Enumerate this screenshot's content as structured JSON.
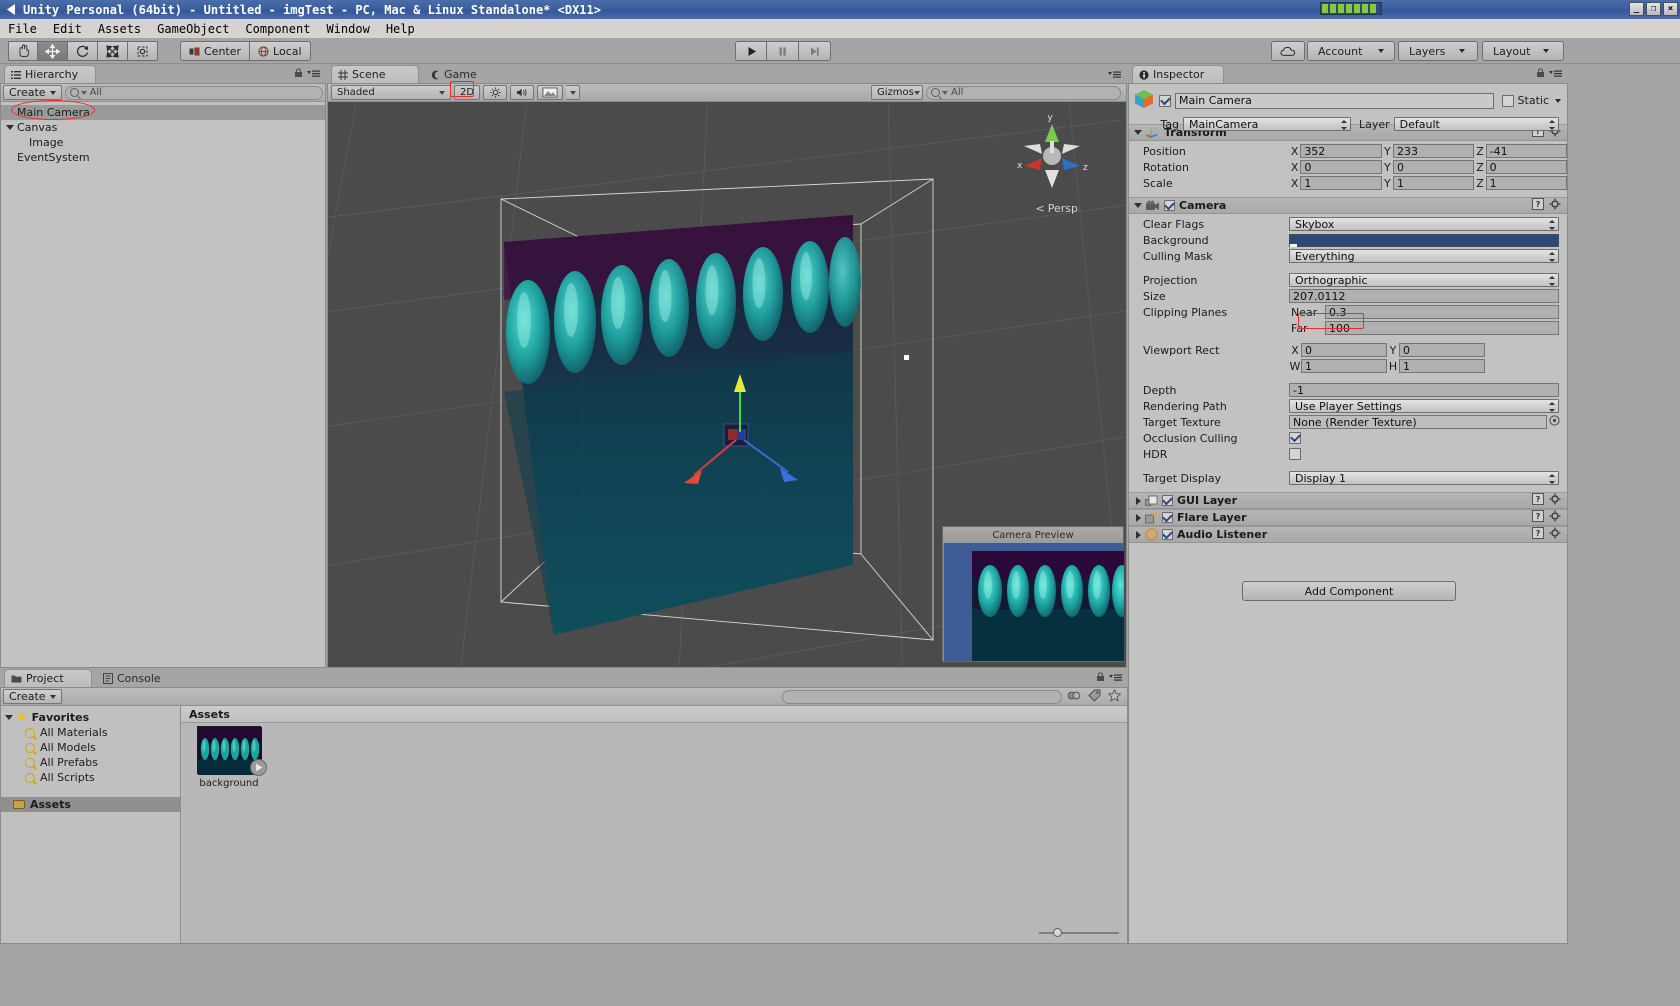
{
  "window": {
    "title": "Unity Personal (64bit) - Untitled - imgTest - PC, Mac & Linux Standalone* <DX11>",
    "minimize_label": "_",
    "restore_label": "❐",
    "close_label": "×"
  },
  "menubar": {
    "items": [
      "File",
      "Edit",
      "Assets",
      "GameObject",
      "Component",
      "Window",
      "Help"
    ]
  },
  "toolbar": {
    "tools": [
      {
        "name": "hand-tool",
        "glyph": "✋"
      },
      {
        "name": "move-tool",
        "glyph": "✥"
      },
      {
        "name": "rotate-tool",
        "glyph": "↻"
      },
      {
        "name": "scale-tool",
        "glyph": "⤢"
      },
      {
        "name": "rect-tool",
        "glyph": "▣"
      }
    ],
    "pivot_label": "Center",
    "space_label": "Local",
    "play_label": "▶",
    "pause_label": "❚❚",
    "step_label": "▶❘",
    "cloud_label": "☁",
    "account_label": "Account",
    "layers_label": "Layers",
    "layout_label": "Layout"
  },
  "hierarchy": {
    "tab_label": "Hierarchy",
    "create_label": "Create",
    "search_placeholder": "All",
    "items": [
      {
        "label": "Main Camera",
        "indent": 0,
        "selected": true,
        "foldout": "none"
      },
      {
        "label": "Canvas",
        "indent": 0,
        "selected": false,
        "foldout": "open"
      },
      {
        "label": "Image",
        "indent": 1,
        "selected": false,
        "foldout": "none"
      },
      {
        "label": "EventSystem",
        "indent": 0,
        "selected": false,
        "foldout": "none"
      }
    ]
  },
  "scene": {
    "tab_scene_label": "Scene",
    "tab_game_label": "Game",
    "shading_label": "Shaded",
    "twod_label": "2D",
    "light_label": "☼",
    "audio_label": "ᴘ",
    "fx_label": "▣",
    "gizmos_label": "Gizmos",
    "search_placeholder": "All",
    "persp_label": "Persp",
    "axis_x": "x",
    "axis_y": "y",
    "axis_z": "z",
    "camera_preview_title": "Camera Preview"
  },
  "inspector": {
    "tab_label": "Inspector",
    "object_name": "Main Camera",
    "static_label": "Static",
    "tag_label": "Tag",
    "tag_value": "MainCamera",
    "layer_label": "Layer",
    "layer_value": "Default",
    "transform": {
      "title": "Transform",
      "rows": [
        {
          "label": "Position",
          "x": "352",
          "y": "233",
          "z": "-41"
        },
        {
          "label": "Rotation",
          "x": "0",
          "y": "0",
          "z": "0"
        },
        {
          "label": "Scale",
          "x": "1",
          "y": "1",
          "z": "1"
        }
      ],
      "axis_x": "X",
      "axis_y": "Y",
      "axis_z": "Z"
    },
    "camera": {
      "title": "Camera",
      "clear_flags_label": "Clear Flags",
      "clear_flags_value": "Skybox",
      "background_label": "Background",
      "background_color": "#2b4a75",
      "culling_mask_label": "Culling Mask",
      "culling_mask_value": "Everything",
      "projection_label": "Projection",
      "projection_value": "Orthographic",
      "size_label": "Size",
      "size_value": "207.0112",
      "clipping_label": "Clipping Planes",
      "near_label": "Near",
      "near_value": "0.3",
      "far_label": "Far",
      "far_value": "100",
      "viewport_label": "Viewport Rect",
      "viewport_x_label": "X",
      "viewport_x": "0",
      "viewport_y_label": "Y",
      "viewport_y": "0",
      "viewport_w_label": "W",
      "viewport_w": "1",
      "viewport_h_label": "H",
      "viewport_h": "1",
      "depth_label": "Depth",
      "depth_value": "-1",
      "rendering_path_label": "Rendering Path",
      "rendering_path_value": "Use Player Settings",
      "target_texture_label": "Target Texture",
      "target_texture_value": "None (Render Texture)",
      "occlusion_label": "Occlusion Culling",
      "occlusion_checked": true,
      "hdr_label": "HDR",
      "hdr_checked": false,
      "target_display_label": "Target Display",
      "target_display_value": "Display 1"
    },
    "components": [
      {
        "title": "GUI Layer",
        "icon": "gui-layer-icon",
        "checked": true
      },
      {
        "title": "Flare Layer",
        "icon": "flare-layer-icon",
        "checked": true
      },
      {
        "title": "Audio Listener",
        "icon": "audio-listener-icon",
        "checked": true
      }
    ],
    "add_component_label": "Add Component"
  },
  "project": {
    "tab_project_label": "Project",
    "tab_console_label": "Console",
    "create_label": "Create",
    "favorites_label": "Favorites",
    "favorites": [
      "All Materials",
      "All Models",
      "All Prefabs",
      "All Scripts"
    ],
    "assets_tree_label": "Assets",
    "assets_header_label": "Assets",
    "search_placeholder": "",
    "items": [
      {
        "label": "background",
        "type": "texture"
      }
    ],
    "zoom_slider_value": 50
  },
  "colors": {
    "title_bar": "#3c5f9e",
    "panel_bg": "#c2c2c2",
    "chrome": "#a5a5a5",
    "scene_bg": "#4b4b4b",
    "annotation_red": "#ef2b2b",
    "accent_teal": "#1faaa4"
  }
}
